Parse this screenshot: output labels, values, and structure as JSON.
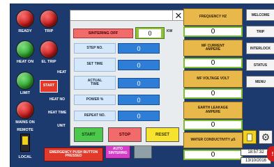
{
  "left_panel": {
    "lamps": [
      {
        "label": "READY",
        "color": "red"
      },
      {
        "label": "TRIP",
        "color": "red"
      },
      {
        "label": "HEAT ON",
        "color": "green"
      },
      {
        "label": "EL TRIP",
        "color": "red"
      },
      {
        "label": "LIMIT",
        "color": "green"
      },
      {
        "label": "MAINS ON",
        "color": "red"
      }
    ],
    "remote_label": "REMOTE",
    "local_label": "LOCAL",
    "heat_header": "HEAT",
    "start_button": "START",
    "heat_no_button": "HEAT NO",
    "heat_time_button": "HEAT TIME",
    "unit_label": "UNIT",
    "emergency_button": "EMERGENCY PUSH BUTTON PRESSED",
    "auto_sintering_button": "AUTO SINTERING"
  },
  "dialog": {
    "title": "",
    "close_icon": "close-icon",
    "sintering_button": "SINTERING OFF",
    "kw_value": "0",
    "kw_unit": "KW",
    "params": [
      {
        "label": "STEP NO.",
        "value": "0"
      },
      {
        "label": "SET TIME",
        "value": "0"
      },
      {
        "label": "ACTUAL TIME",
        "value": "0"
      },
      {
        "label": "POWER %",
        "value": "0"
      },
      {
        "label": "REPEAT NO.",
        "value": "0"
      }
    ],
    "start_button": "START",
    "stop_button": "STOP",
    "reset_button": "RESET"
  },
  "meters": [
    {
      "label": "FREQUENCY HZ",
      "value": "0"
    },
    {
      "label": "MF CURRENT AMPERE",
      "value": "0"
    },
    {
      "label": "MF VOLTAGE VOLT",
      "value": "0"
    },
    {
      "label": "EARTH LEAKAGE AMPERE",
      "value": "0"
    },
    {
      "label": "WATER CONDUCTIVITY µS",
      "value": "0"
    }
  ],
  "nav": [
    "WELCOME",
    "TRIP",
    "INTERLOCK",
    "STATUS",
    "MENU"
  ],
  "clock": {
    "time": "18:57:32",
    "date": "13/10/2016"
  },
  "colors": {
    "screen_bg": "#1c3a6e",
    "meter_label": "#e8b84a",
    "param_value": "#2e7dd6",
    "start": "#4cc94c",
    "stop": "#f26b6b",
    "reset": "#f5e330"
  }
}
